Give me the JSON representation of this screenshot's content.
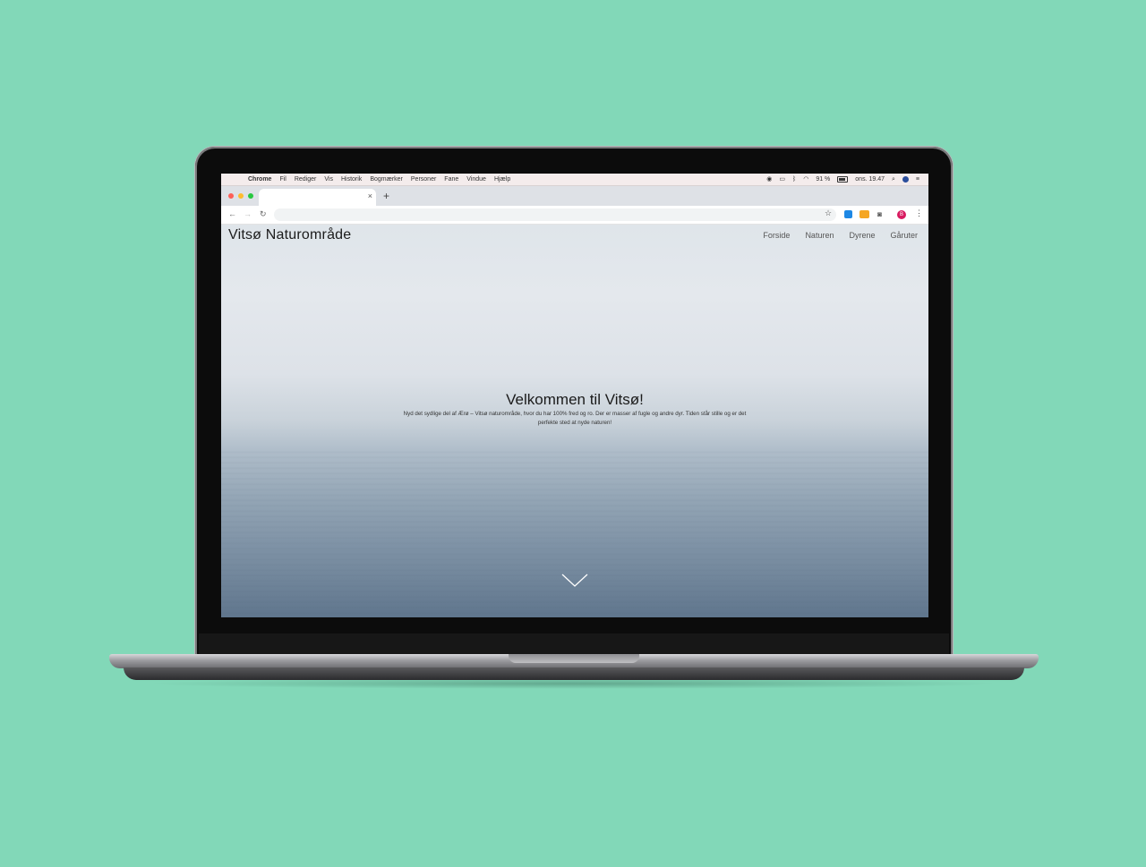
{
  "colors": {
    "background": "#82d8b8",
    "menubar_bg": "#f4ecec",
    "tabstrip_bg": "#dee1e6",
    "profile_badge": "#d81b60"
  },
  "menubar": {
    "apple_icon": "apple-icon",
    "app_name": "Chrome",
    "items": [
      "Fil",
      "Rediger",
      "Vis",
      "Historik",
      "Bogmærker",
      "Personer",
      "Fane",
      "Vindue",
      "Hjælp"
    ],
    "battery_percent": "91 %",
    "clock": "ons. 19.47"
  },
  "tabstrip": {
    "tab_close": "×",
    "new_tab": "+"
  },
  "toolbar": {
    "back": "←",
    "forward": "→",
    "reload": "↻",
    "bookmark_star": "☆",
    "profile_initial": "B",
    "menu": "⋮"
  },
  "site": {
    "logo": "Vitsø Naturområde",
    "nav": [
      "Forside",
      "Naturen",
      "Dyrene",
      "Gåruter"
    ],
    "hero_title": "Velkommen til Vitsø!",
    "hero_text": "Nyd det sydlige del af Ærø – Vitsø naturområde, hvor du har 100% fred og ro. Der er masser af fugle og andre dyr. Tiden står stille og er det perfekte sted at nyde naturen!"
  }
}
